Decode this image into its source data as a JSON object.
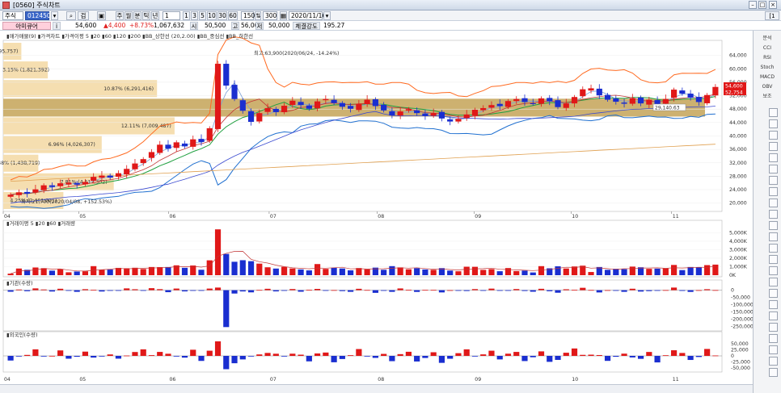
{
  "window": {
    "title": "[0560] 주식차트",
    "date_badge": "[1일]"
  },
  "toolbar": {
    "market": "주식",
    "code": "012450",
    "search_label": "검색",
    "periods": [
      "주",
      "월",
      "분",
      "틱",
      "년"
    ],
    "period_value": "1",
    "interval_buttons": [
      "1",
      "3",
      "5",
      "10",
      "30",
      "60"
    ],
    "count_value": "150",
    "count_total": "300",
    "date_value": "2020/11/16"
  },
  "info": {
    "name": "아미큐어",
    "price": "54,600",
    "change": "▲4,400",
    "change_pct": "+8.73%",
    "volume": "1,067,632",
    "open_label": "시",
    "open": "50,500",
    "high_label": "고",
    "high": "56,000",
    "low_label": "저",
    "low": "50,000",
    "strength_label": "체결강도",
    "strength": "195.27"
  },
  "main_legend": [
    "▮매가매물(9)",
    "▮가격차트",
    "▮가격이평 5",
    "▮20",
    "▮60",
    "▮120",
    "▮200",
    "▮BB_상한선 (20,2.00)",
    "▮BB_중심선",
    "▮BB_하한선"
  ],
  "volume_legend": [
    "▮거래이평 5",
    "▮20",
    "▮60",
    "▮거래량"
  ],
  "inst_legend": "▮기관(수량)",
  "foreign_legend": "▮외국인(수량)",
  "annotations": {
    "max": "최고:63,900(2020/06/24, -14.24%)",
    "min": "최저:21,700(2020/04/08, +152.53%)",
    "now_box": "29,140.63",
    "price_tag_1": "54,600",
    "price_tag_2": "52,754"
  },
  "volume_profile": [
    {
      "label": "1.28% (695,757)",
      "pct": 1.28
    },
    {
      "label": "3.15% (1,821,392)",
      "pct": 3.15
    },
    {
      "label": "10.87% (6,291,416)",
      "pct": 10.87
    },
    {
      "label": "",
      "pct": 55.0,
      "highlight": true
    },
    {
      "label": "12.11% (7,009,487)",
      "pct": 12.11
    },
    {
      "label": "6.96% (4,026,307)",
      "pct": 6.96
    },
    {
      "label": "2.48% (1,438,719)",
      "pct": 2.48
    },
    {
      "label": "7.81% (4,517,302)",
      "pct": 7.81
    },
    {
      "label": "4.25% (2,461,001)",
      "pct": 4.25
    }
  ],
  "chart_data": {
    "type": "candlestick",
    "x_months": [
      "04",
      "05",
      "06",
      "07",
      "08",
      "09",
      "10",
      "11"
    ],
    "price_axis": {
      "ticks": [
        20000,
        24000,
        28000,
        32000,
        36000,
        40000,
        44000,
        48000,
        52000,
        56000,
        60000,
        64000
      ],
      "labels": [
        "20,000",
        "24,000",
        "28,000",
        "32,000",
        "36,000",
        "40,000",
        "44,000",
        "48,000",
        "52,000",
        "56,000",
        "60,000",
        "64,000"
      ],
      "ylim": [
        18000,
        68000
      ]
    },
    "volume_axis": {
      "ticks": [
        0,
        1000,
        2000,
        3000,
        4000,
        5000
      ],
      "labels": [
        "0K",
        "1,000K",
        "2,000K",
        "3,000K",
        "4,000K",
        "5,000K"
      ],
      "ylim": [
        0,
        5800
      ]
    },
    "inst_axis": {
      "ticks": [
        0,
        -50000,
        -100000,
        -150000,
        -200000,
        -250000
      ],
      "labels": [
        "0",
        "-50,000",
        "-100,000",
        "-150,000",
        "-200,000",
        "-250,000"
      ],
      "ylim": [
        -270000,
        20000
      ]
    },
    "foreign_axis": {
      "ticks": [
        50000,
        25000,
        0,
        -25000,
        -50000
      ],
      "labels": [
        "50,000",
        "25,000",
        "0",
        "-25,000",
        "-50,000"
      ],
      "ylim": [
        -60000,
        70000
      ]
    },
    "close_path": [
      22500,
      23200,
      22800,
      24100,
      25300,
      24800,
      25900,
      26100,
      25500,
      26300,
      27800,
      28200,
      27600,
      28900,
      30200,
      31800,
      33100,
      35200,
      37400,
      36200,
      38100,
      36900,
      39000,
      38200,
      42300,
      61500,
      55000,
      51000,
      47500,
      44200,
      46800,
      48300,
      47100,
      49000,
      50500,
      49200,
      48100,
      50300,
      51000,
      49800,
      48700,
      48100,
      49600,
      50800,
      48900,
      47600,
      46100,
      47300,
      48000,
      46800,
      45900,
      46800,
      45200,
      44300,
      45100,
      46400,
      47800,
      48300,
      49200,
      48900,
      50400,
      51000,
      50100,
      49700,
      51200,
      50300,
      48600,
      49700,
      51600,
      53900,
      54200,
      52100,
      50800,
      50200,
      49600,
      51200,
      49700,
      50800,
      49500,
      51000,
      53800,
      52600,
      51400,
      50100,
      52200,
      54600
    ],
    "colors": {
      "up": "#e01818",
      "down": "#1a2ed0",
      "ma5": "#7aa0d8",
      "ma20": "#c23636",
      "ma60": "#3a4ad0",
      "ma120": "#e0a050",
      "bb_upper": "#ff6a20",
      "bb_mid": "#20a040",
      "bb_lower": "#2070d0",
      "band": "#c8a860",
      "profile": "#f5deb0"
    }
  },
  "side_buttons": [
    "분석",
    "CCI",
    "RSI",
    "Stoch",
    "MACD",
    "OBV",
    "보조"
  ]
}
